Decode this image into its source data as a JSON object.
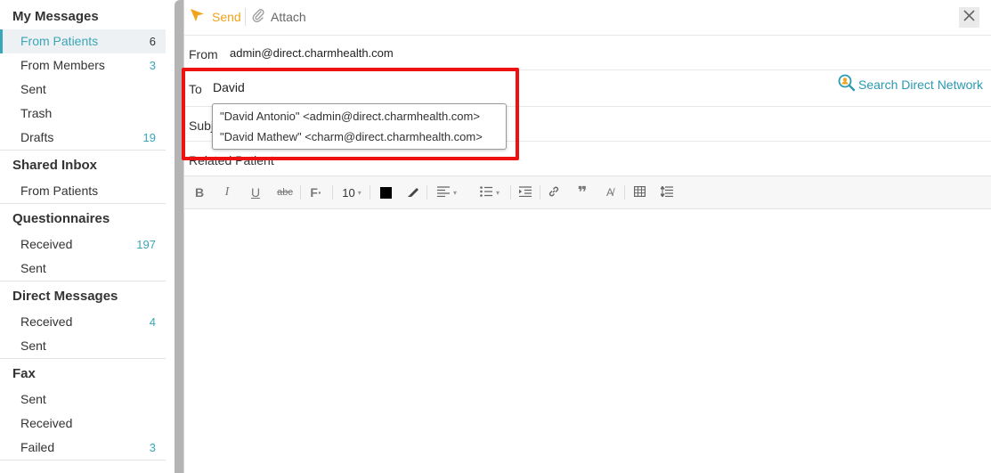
{
  "sidebar": {
    "my_messages": {
      "title": "My Messages",
      "items": [
        {
          "label": "From Patients",
          "count": "6"
        },
        {
          "label": "From Members",
          "count": "3"
        },
        {
          "label": "Sent",
          "count": ""
        },
        {
          "label": "Trash",
          "count": ""
        },
        {
          "label": "Drafts",
          "count": "19"
        }
      ]
    },
    "shared_inbox": {
      "title": "Shared Inbox",
      "items": [
        {
          "label": "From Patients",
          "count": ""
        }
      ]
    },
    "questionnaires": {
      "title": "Questionnaires",
      "items": [
        {
          "label": "Received",
          "count": "197"
        },
        {
          "label": "Sent",
          "count": ""
        }
      ]
    },
    "direct_messages": {
      "title": "Direct Messages",
      "items": [
        {
          "label": "Received",
          "count": "4"
        },
        {
          "label": "Sent",
          "count": ""
        }
      ]
    },
    "fax": {
      "title": "Fax",
      "items": [
        {
          "label": "Sent",
          "count": ""
        },
        {
          "label": "Received",
          "count": ""
        },
        {
          "label": "Failed",
          "count": "3"
        }
      ]
    }
  },
  "toolbar": {
    "send_label": "Send",
    "attach_label": "Attach"
  },
  "compose": {
    "from_label": "From",
    "from_value": "admin@direct.charmhealth.com",
    "to_label": "To",
    "to_value": "David",
    "search_direct_label": "Search Direct Network",
    "subject_label": "Subject",
    "subject_visible": "Subj",
    "related_label": "Related Patient"
  },
  "editor": {
    "font_size": "10"
  },
  "autocomplete": [
    "\"David Antonio\" <admin@direct.charmhealth.com>",
    "\"David Mathew\" <charm@direct.charmhealth.com>"
  ],
  "colors": {
    "accent": "#3aa6b9",
    "send": "#f0a41b",
    "highlight": "#ee1111"
  }
}
